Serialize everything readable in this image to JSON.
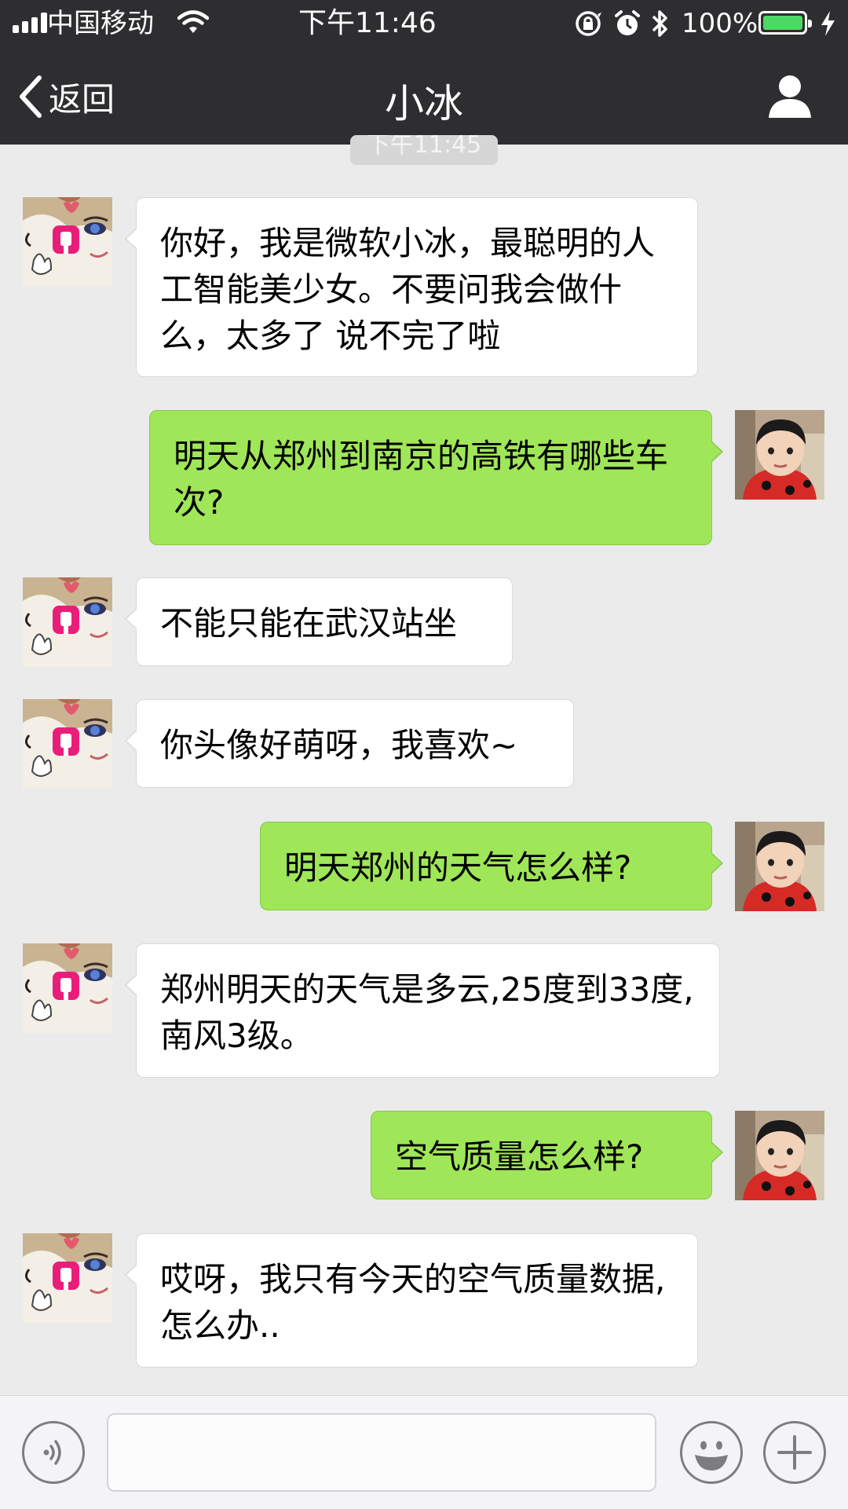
{
  "status_bar": {
    "carrier": "中国移动",
    "time": "下午11:46",
    "battery_percent": "100%",
    "battery_level": 1.0,
    "icons": [
      "signal-icon",
      "wifi-icon",
      "orientation-lock-icon",
      "alarm-icon",
      "bluetooth-icon",
      "battery-icon",
      "charging-icon"
    ]
  },
  "nav": {
    "back_label": "返回",
    "title": "小冰",
    "right_icon": "profile-icon"
  },
  "timestamp": "下午11:45",
  "messages": [
    {
      "from": "bot",
      "text": "你好，我是微软小冰，最聪明的人工智能美少女。不要问我会做什么，太多了 说不完了啦"
    },
    {
      "from": "user",
      "text": "明天从郑州到南京的高铁有哪些车次?"
    },
    {
      "from": "bot",
      "text": "不能只能在武汉站坐"
    },
    {
      "from": "bot",
      "text": "你头像好萌呀，我喜欢~"
    },
    {
      "from": "user",
      "text": "明天郑州的天气怎么样?"
    },
    {
      "from": "bot",
      "text": "郑州明天的天气是多云,25度到33度,南风3级。"
    },
    {
      "from": "user",
      "text": "空气质量怎么样?"
    },
    {
      "from": "bot",
      "text": "哎呀，我只有今天的空气质量数据,怎么办.."
    }
  ],
  "input_bar": {
    "value": "",
    "left_icon": "voice-icon",
    "emoji_icon": "emoji-icon",
    "plus_icon": "plus-icon"
  },
  "colors": {
    "header_bg": "#2e2e31",
    "chat_bg": "#ebebeb",
    "outgoing_bubble": "#9fe658",
    "incoming_bubble": "#ffffff",
    "battery_green": "#4cd964"
  }
}
